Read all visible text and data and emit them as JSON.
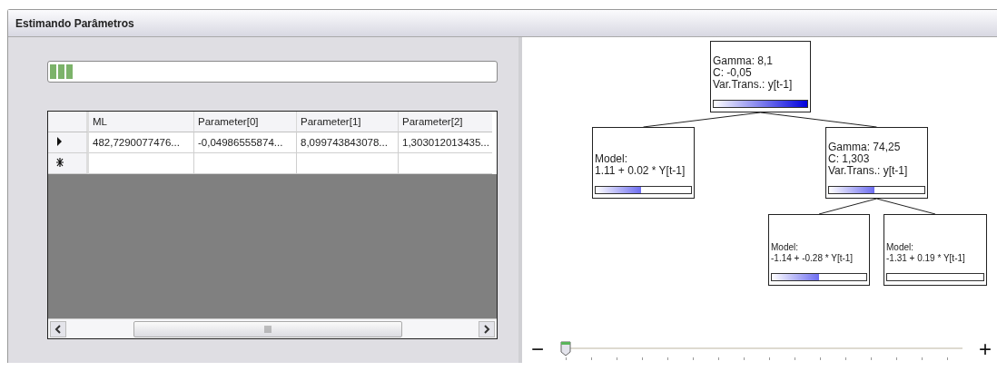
{
  "window": {
    "title": "Estimando Parâmetros"
  },
  "progress": {
    "level": 0.055
  },
  "table": {
    "columns": [
      "ML",
      "Parameter[0]",
      "Parameter[1]",
      "Parameter[2]"
    ],
    "rows": [
      {
        "kind": "current",
        "cells": [
          "482,7290077476...",
          "-0,04986555874...",
          "8,099743843078...",
          "1,303012013435..."
        ]
      },
      {
        "kind": "new",
        "cells": [
          "",
          "",
          "",
          ""
        ]
      }
    ]
  },
  "tree": {
    "lines": [
      "Gamma: 8,1",
      "C: -0,05",
      "Var.Trans.: y[t-1]"
    ],
    "level": 1,
    "children": [
      {
        "lines": [
          "Model:",
          "1.11 + 0.02 * Y[t-1]"
        ],
        "level": 0.48
      },
      {
        "lines": [
          "Gamma: 74,25",
          "C: 1,303",
          "Var.Trans.: y[t-1]"
        ],
        "level": 0.48,
        "children": [
          {
            "lines": [
              "Model:",
              "-1.14 + -0.28 *  Y[t-1]"
            ],
            "level": 0.5
          },
          {
            "lines": [
              "Model:",
              "-1.31 + 0.19 * Y[t-1]"
            ],
            "level": 0
          }
        ]
      }
    ]
  },
  "zoom": {
    "minus": "−",
    "plus": "+",
    "level": 0
  }
}
